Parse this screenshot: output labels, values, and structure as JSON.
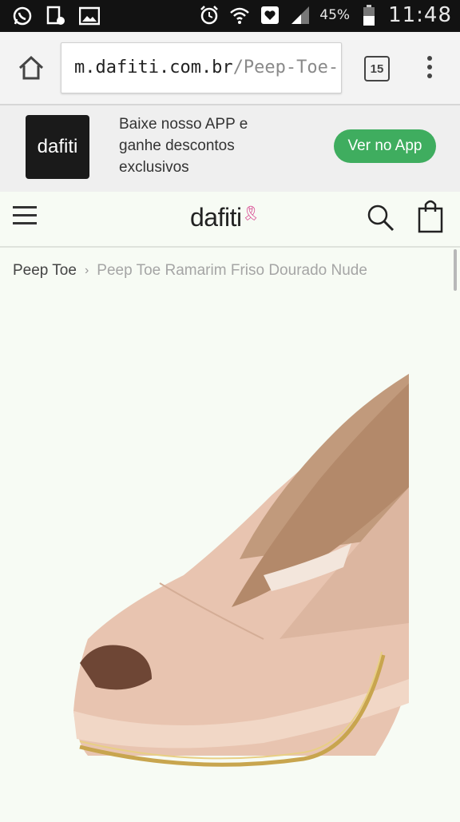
{
  "status_bar": {
    "battery": "45%",
    "time": "11:48",
    "icons": [
      "whatsapp-icon",
      "notification-icon",
      "gallery-icon",
      "alarm-icon",
      "wifi-icon",
      "heart-app-icon",
      "signal-icon",
      "battery-icon"
    ]
  },
  "browser": {
    "url_domain": "m.dafiti.com.br",
    "url_path": "/Peep-Toe-",
    "tab_count": "15"
  },
  "app_banner": {
    "logo_text": "dafiti",
    "line1": "Baixe nosso APP e",
    "line2": "ganhe descontos",
    "line3": "exclusivos",
    "button_label": "Ver no App",
    "button_color": "#3fad5f"
  },
  "header": {
    "logo_text": "dafiti",
    "ribbon_color": "#d63c8a"
  },
  "breadcrumb": {
    "parent": "Peep Toe",
    "separator": "›",
    "current": "Peep Toe Ramarim Friso Dourado Nude"
  },
  "product": {
    "image_description_icon": "nude-peep-toe-shoe-image"
  }
}
